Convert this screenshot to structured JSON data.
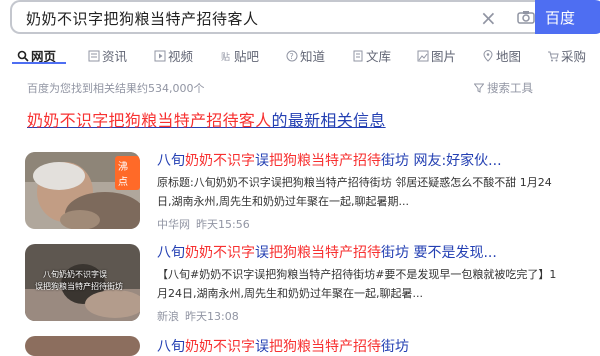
{
  "search": {
    "query": "奶奶不识字把狗粮当特产招待客人",
    "button_label": "百度"
  },
  "tabs": [
    {
      "label": "网页",
      "icon": "search-icon",
      "active": true
    },
    {
      "label": "资讯",
      "icon": "news-icon"
    },
    {
      "label": "视频",
      "icon": "video-icon"
    },
    {
      "label": "贴吧",
      "icon": "tieba-icon"
    },
    {
      "label": "知道",
      "icon": "question-icon"
    },
    {
      "label": "文库",
      "icon": "document-icon"
    },
    {
      "label": "图片",
      "icon": "image-icon"
    },
    {
      "label": "地图",
      "icon": "map-icon"
    },
    {
      "label": "采购",
      "icon": "shopping-icon"
    }
  ],
  "results_stats": "百度为您找到相关结果约534,000个",
  "search_tools": "搜索工具",
  "news_header": {
    "highlight": "奶奶不识字把狗粮当特产招待客人",
    "rest": "的最新相关信息"
  },
  "results": [
    {
      "title_parts": [
        {
          "text": "八旬",
          "hl": false
        },
        {
          "text": "奶奶不识字",
          "hl": true
        },
        {
          "text": "误",
          "hl": false
        },
        {
          "text": "把狗粮当特产招待",
          "hl": true
        },
        {
          "text": "街坊 网友:好家伙...",
          "hl": false
        }
      ],
      "desc": "原标题:八旬奶奶不识字误把狗粮当特产招待街坊 邻居还疑惑怎么不酸不甜 1月24日,湖南永州,周先生和奶奶过年聚在一起,聊起暑期...",
      "source": "中华网",
      "time": "昨天15:56",
      "badge": "沸点"
    },
    {
      "title_parts": [
        {
          "text": "八旬",
          "hl": false
        },
        {
          "text": "奶奶不识字",
          "hl": true
        },
        {
          "text": "误",
          "hl": false
        },
        {
          "text": "把狗粮当特产招待",
          "hl": true
        },
        {
          "text": "街坊 要不是发现...",
          "hl": false
        }
      ],
      "desc": "【八旬#奶奶不识字误把狗粮当特产招待街坊#要不是发现早一包粮就被吃完了】1月24日,湖南永州,周先生和奶奶过年聚在一起,聊起暑...",
      "source": "新浪",
      "time": "昨天13:08",
      "thumb_caption_1": "八旬奶奶不识字误",
      "thumb_caption_2": "误把狗粮当特产招待街坊"
    },
    {
      "title_parts": [
        {
          "text": "八旬",
          "hl": false
        },
        {
          "text": "奶奶不识字",
          "hl": true
        },
        {
          "text": "误",
          "hl": false
        },
        {
          "text": "把狗粮当特产招待",
          "hl": true
        },
        {
          "text": "街坊",
          "hl": false
        }
      ]
    }
  ],
  "colors": {
    "accent": "#4e6ef2",
    "link": "#2440b3",
    "highlight": "#f73131",
    "muted": "#9195a3",
    "badge": "#ff6a28"
  }
}
